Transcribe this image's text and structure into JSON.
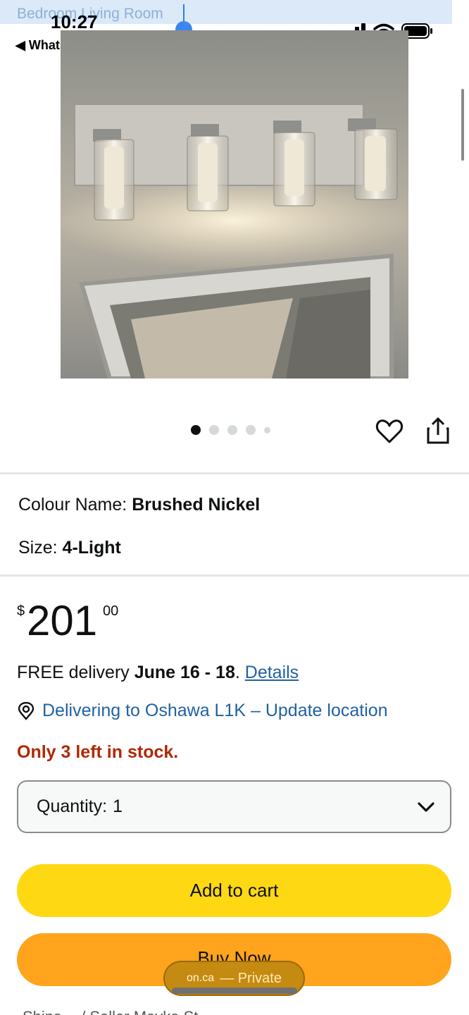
{
  "status_bar": {
    "selected_text": "Bedroom Living Room",
    "time": "10:27",
    "back_label": "◀ WhatsApp"
  },
  "carousel": {
    "count": 5,
    "active_index": 0
  },
  "variants": {
    "colour_label": "Colour Name:",
    "colour_value": "Brushed Nickel",
    "size_label": "Size:",
    "size_value": "4-Light"
  },
  "price": {
    "symbol": "$",
    "whole": "201",
    "fraction": "00"
  },
  "delivery": {
    "prefix": "FREE delivery ",
    "date": "June 16 - 18",
    "suffix": ". ",
    "details_link": "Details"
  },
  "location": {
    "text": "Delivering to Oshawa L1K – Update location"
  },
  "stock": {
    "text": "Only 3 left in stock."
  },
  "quantity": {
    "label": "Quantity:",
    "value": "1"
  },
  "buttons": {
    "add_to_cart": "Add to cart",
    "buy_now": "Buy Now"
  },
  "browser": {
    "domain": "on.ca",
    "mode": "— Private"
  },
  "footer_hint": "Ships… / Seller Mavka St…",
  "colors": {
    "add_to_cart": "#ffd814",
    "buy_now": "#ffa41c",
    "link": "#2162a1",
    "stock_warning": "#b12704"
  }
}
